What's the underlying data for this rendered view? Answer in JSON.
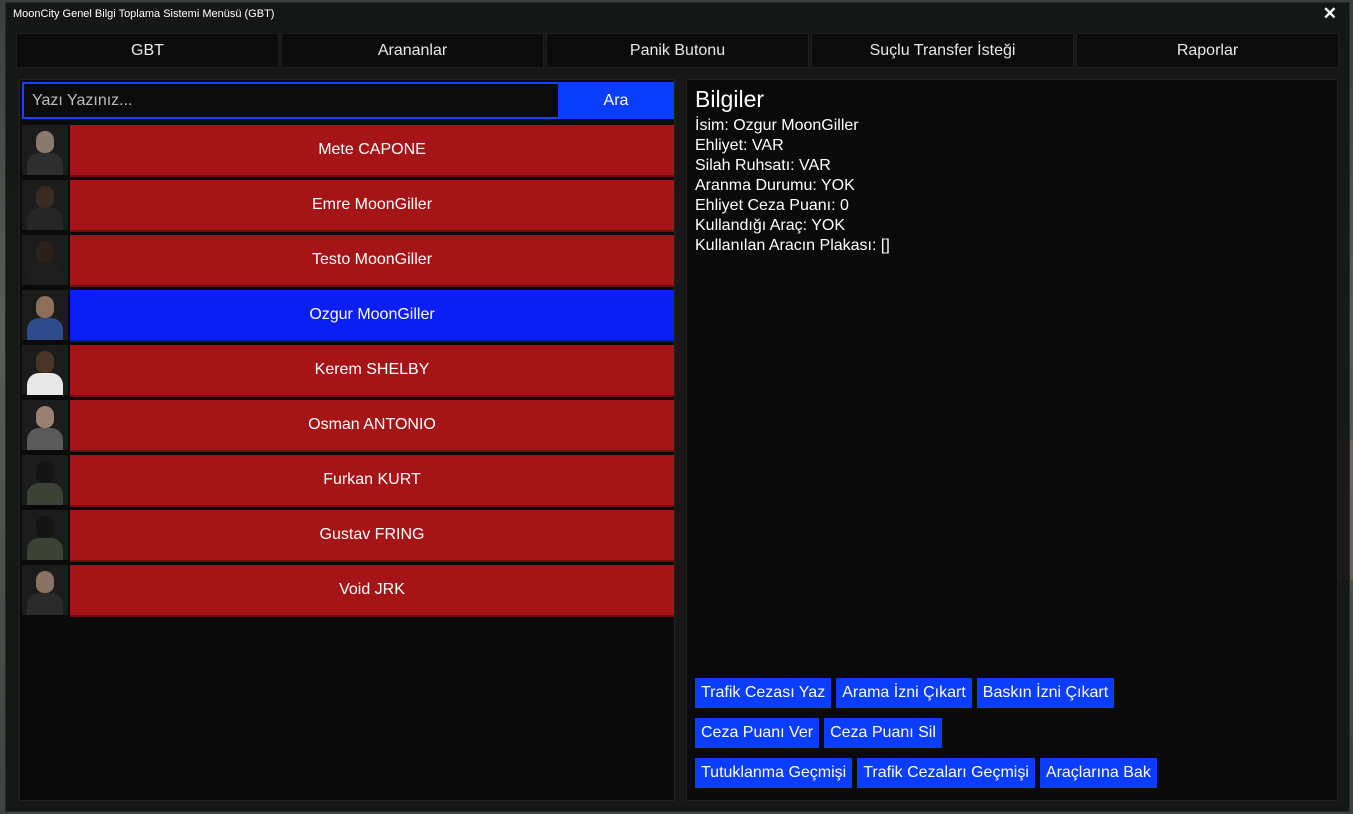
{
  "window": {
    "title": "MoonCity Genel Bilgi Toplama Sistemi Menüsü (GBT)",
    "close_symbol": "✕"
  },
  "tabs": [
    "GBT",
    "Arananlar",
    "Panik Butonu",
    "Suçlu Transfer İsteği",
    "Raporlar"
  ],
  "search": {
    "placeholder": "Yazı Yazınız...",
    "value": "",
    "button_label": "Ara"
  },
  "players": [
    {
      "name": "Mete CAPONE",
      "selected": false,
      "skin": "#8a7a6e",
      "clothes": "#2e2e2e"
    },
    {
      "name": "Emre MoonGiller",
      "selected": false,
      "skin": "#3a2a22",
      "clothes": "#262626"
    },
    {
      "name": "Testo MoonGiller",
      "selected": false,
      "skin": "#2b211b",
      "clothes": "#1e1e1e"
    },
    {
      "name": "Ozgur MoonGiller",
      "selected": true,
      "skin": "#8d6f5c",
      "clothes": "#2d4b8a"
    },
    {
      "name": "Kerem SHELBY",
      "selected": false,
      "skin": "#4a3428",
      "clothes": "#e8e8e8"
    },
    {
      "name": "Osman ANTONIO",
      "selected": false,
      "skin": "#9a8070",
      "clothes": "#5a5a5a"
    },
    {
      "name": "Furkan KURT",
      "selected": false,
      "skin": "#141414",
      "clothes": "#3c4236"
    },
    {
      "name": "Gustav FRING",
      "selected": false,
      "skin": "#141414",
      "clothes": "#3c4236"
    },
    {
      "name": "Void JRK",
      "selected": false,
      "skin": "#8a7262",
      "clothes": "#2a2a2a"
    }
  ],
  "info": {
    "title": "Bilgiler",
    "lines": [
      "İsim: Ozgur MoonGiller",
      "Ehliyet: VAR",
      "Silah Ruhsatı: VAR",
      "Aranma Durumu: YOK",
      "Ehliyet Ceza Puanı: 0",
      "Kullandığı Araç: YOK",
      "Kullanılan Aracın Plakası: []"
    ]
  },
  "actions": [
    [
      "Trafik Cezası Yaz",
      "Arama İzni Çıkart",
      "Baskın İzni Çıkart"
    ],
    [
      "Ceza Puanı Ver",
      "Ceza Puanı Sil"
    ],
    [
      "Tutuklanma Geçmişi",
      "Trafik Cezaları Geçmişi",
      "Araçlarına Bak"
    ]
  ]
}
